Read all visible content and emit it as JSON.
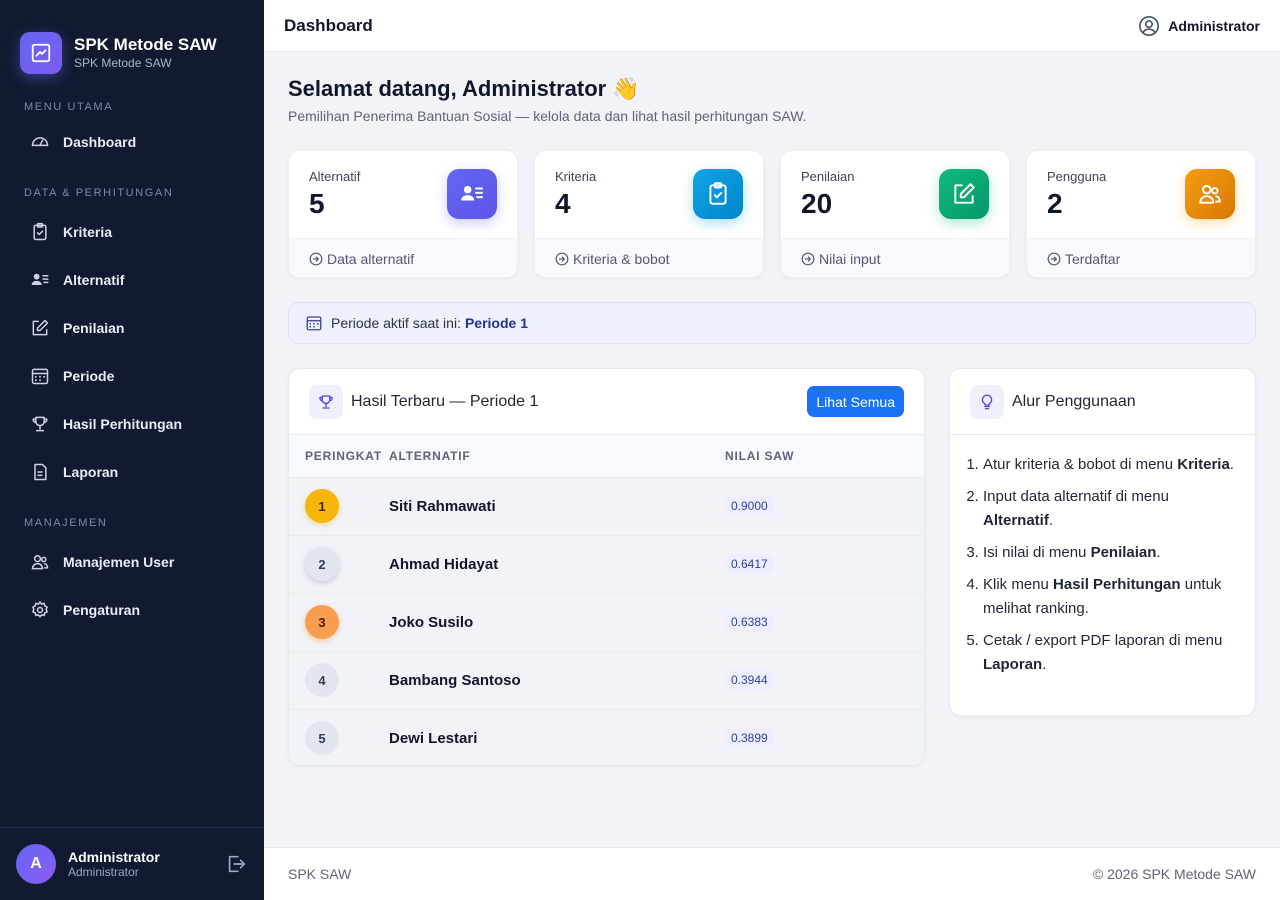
{
  "brand": {
    "title": "SPK Metode SAW",
    "subtitle": "SPK Metode SAW"
  },
  "sidebar": {
    "sections": [
      {
        "label": "MENU UTAMA",
        "items": [
          {
            "label": "Dashboard",
            "icon": "dashboard-gauge-icon"
          }
        ]
      },
      {
        "label": "DATA & PERHITUNGAN",
        "items": [
          {
            "label": "Kriteria",
            "icon": "clipboard-check-icon"
          },
          {
            "label": "Alternatif",
            "icon": "user-list-icon"
          },
          {
            "label": "Penilaian",
            "icon": "edit-icon"
          },
          {
            "label": "Periode",
            "icon": "calendar-icon"
          },
          {
            "label": "Hasil Perhitungan",
            "icon": "trophy-icon"
          },
          {
            "label": "Laporan",
            "icon": "document-icon"
          }
        ]
      },
      {
        "label": "MANAJEMEN",
        "items": [
          {
            "label": "Manajemen User",
            "icon": "users-icon"
          },
          {
            "label": "Pengaturan",
            "icon": "gear-icon"
          }
        ]
      }
    ],
    "user": {
      "initial": "A",
      "name": "Administrator",
      "role": "Administrator"
    }
  },
  "topbar": {
    "title": "Dashboard",
    "user": "Administrator"
  },
  "welcome": {
    "title": "Selamat datang, Administrator 👋",
    "subtitle": "Pemilihan Penerima Bantuan Sosial — kelola data dan lihat hasil perhitungan SAW."
  },
  "stats": [
    {
      "label": "Alternatif",
      "value": "5",
      "foot": "Data alternatif",
      "color": "#6366f1"
    },
    {
      "label": "Kriteria",
      "value": "4",
      "foot": "Kriteria & bobot",
      "color": "#0ea5e9"
    },
    {
      "label": "Penilaian",
      "value": "20",
      "foot": "Nilai input",
      "color": "#10b981"
    },
    {
      "label": "Pengguna",
      "value": "2",
      "foot": "Terdaftar",
      "color": "#f59e0b"
    }
  ],
  "period": {
    "label": "Periode aktif saat ini:",
    "value": "Periode 1"
  },
  "results": {
    "title": "Hasil Terbaru — Periode 1",
    "button": "Lihat Semua",
    "columns": [
      "PERINGKAT",
      "ALTERNATIF",
      "NILAI SAW"
    ],
    "rows": [
      {
        "rank": "1",
        "name": "Siti Rahmawati",
        "score": "0.9000"
      },
      {
        "rank": "2",
        "name": "Ahmad Hidayat",
        "score": "0.6417"
      },
      {
        "rank": "3",
        "name": "Joko Susilo",
        "score": "0.6383"
      },
      {
        "rank": "4",
        "name": "Bambang Santoso",
        "score": "0.3944"
      },
      {
        "rank": "5",
        "name": "Dewi Lestari",
        "score": "0.3899"
      }
    ]
  },
  "flow": {
    "title": "Alur Penggunaan",
    "steps": [
      {
        "pre": "Atur kriteria & bobot di menu ",
        "bold": "Kriteria",
        "post": "."
      },
      {
        "pre": "Input data alternatif di menu ",
        "bold": "Alternatif",
        "post": "."
      },
      {
        "pre": "Isi nilai di menu ",
        "bold": "Penilaian",
        "post": "."
      },
      {
        "pre": "Klik menu ",
        "bold": "Hasil Perhitungan",
        "post": " untuk melihat ranking."
      },
      {
        "pre": "Cetak / export PDF laporan di menu ",
        "bold": "Laporan",
        "post": "."
      }
    ]
  },
  "footer": {
    "left": "SPK SAW",
    "right": "© 2026 SPK Metode SAW"
  }
}
